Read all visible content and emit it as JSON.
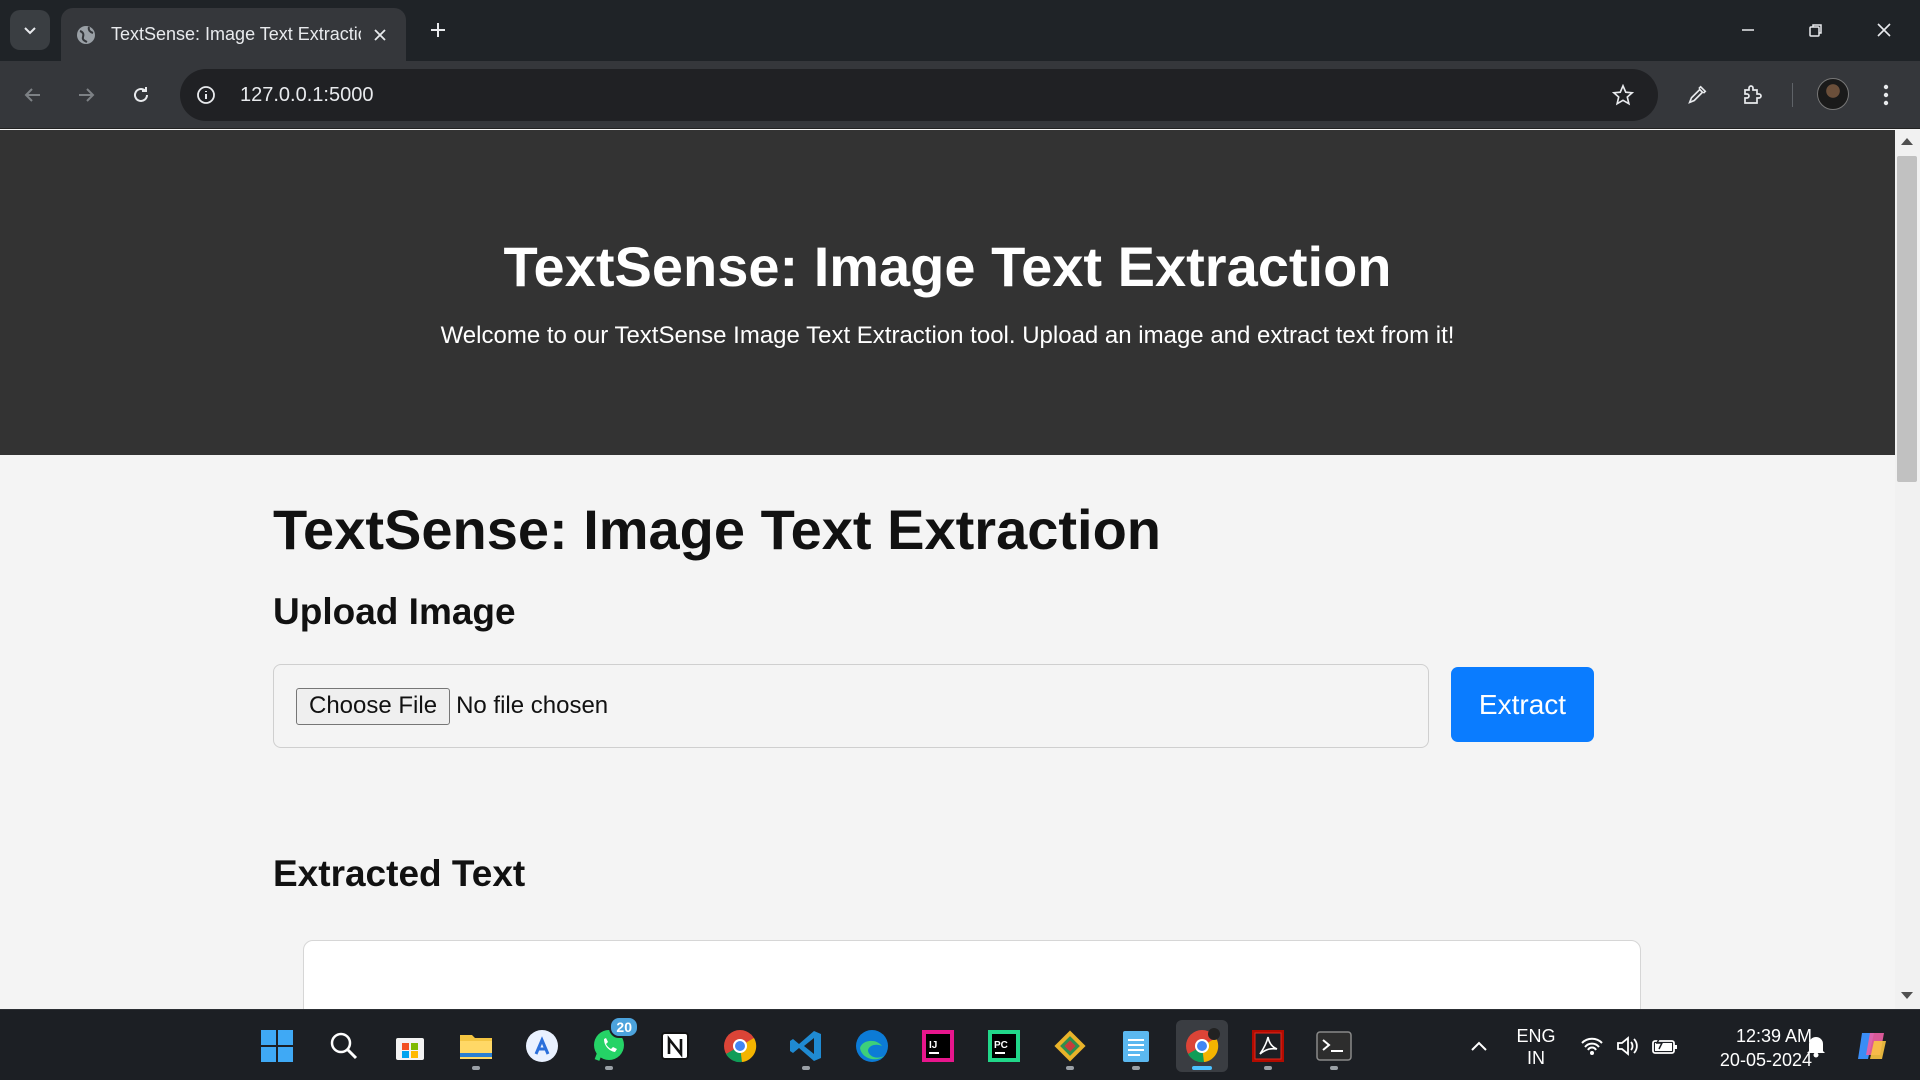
{
  "browser": {
    "tab_title": "TextSense: Image Text Extraction",
    "url": "127.0.0.1:5000"
  },
  "hero": {
    "title": "TextSense: Image Text Extraction",
    "subtitle": "Welcome to our TextSense Image Text Extraction tool. Upload an image and extract text from it!"
  },
  "main": {
    "heading": "TextSense: Image Text Extraction",
    "upload_heading": "Upload Image",
    "choose_file_label": "Choose File",
    "file_status": "No file chosen",
    "extract_label": "Extract",
    "extracted_heading": "Extracted Text",
    "extracted_text": ""
  },
  "taskbar": {
    "apps": [
      "start",
      "search",
      "microsoft-store",
      "file-explorer",
      "app-store",
      "whatsapp",
      "notion",
      "chrome",
      "vs-code",
      "edge",
      "intellij",
      "pycharm",
      "git",
      "notepad",
      "chrome-active",
      "acrobat",
      "terminal"
    ],
    "whatsapp_badge": "20",
    "language_line1": "ENG",
    "language_line2": "IN",
    "time": "12:39 AM",
    "date": "20-05-2024"
  }
}
